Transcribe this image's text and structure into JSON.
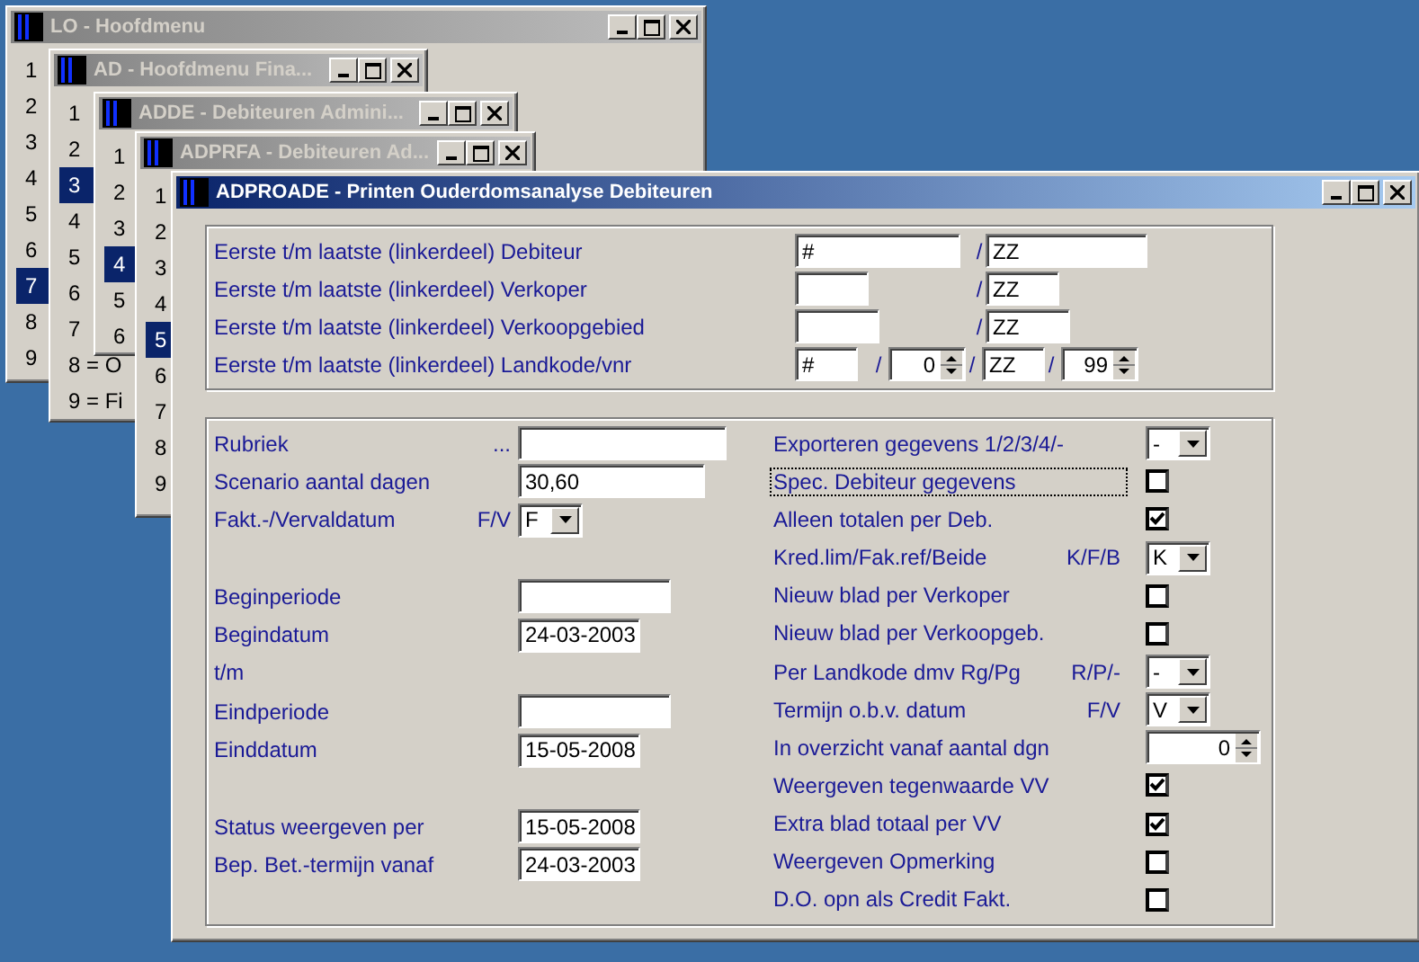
{
  "back_windows": [
    {
      "title": "LO - Hoofdmenu",
      "items": [
        {
          "label": "1",
          "selected": false
        },
        {
          "label": "2",
          "selected": false
        },
        {
          "label": "3",
          "selected": false
        },
        {
          "label": "4",
          "selected": false
        },
        {
          "label": "5",
          "selected": false
        },
        {
          "label": "6",
          "selected": false
        },
        {
          "label": "7",
          "selected": true
        },
        {
          "label": "8",
          "selected": false
        },
        {
          "label": "9",
          "selected": false
        }
      ]
    },
    {
      "title": "AD - Hoofdmenu Fina...",
      "items": [
        {
          "label": "1",
          "selected": false
        },
        {
          "label": "2",
          "selected": false
        },
        {
          "label": "3",
          "selected": true
        },
        {
          "label": "4",
          "selected": false
        },
        {
          "label": "5",
          "selected": false
        },
        {
          "label": "6",
          "selected": false
        },
        {
          "label": "7",
          "selected": false
        },
        {
          "label": "8 = O",
          "selected": false
        },
        {
          "label": "9 = Fi",
          "selected": false
        }
      ]
    },
    {
      "title": "ADDE - Debiteuren Admini...",
      "items": [
        {
          "label": "1",
          "selected": false
        },
        {
          "label": "2",
          "selected": false
        },
        {
          "label": "3",
          "selected": false
        },
        {
          "label": "4",
          "selected": true
        },
        {
          "label": "5",
          "selected": false
        },
        {
          "label": "6",
          "selected": false
        }
      ]
    },
    {
      "title": "ADPRFA - Debiteuren Ad...",
      "items": [
        {
          "label": "1",
          "selected": false
        },
        {
          "label": "2",
          "selected": false
        },
        {
          "label": "3",
          "selected": false
        },
        {
          "label": "4",
          "selected": false
        },
        {
          "label": "5",
          "selected": true
        },
        {
          "label": "6",
          "selected": false
        },
        {
          "label": "7",
          "selected": false
        },
        {
          "label": "8",
          "selected": false
        },
        {
          "label": "9",
          "selected": false
        }
      ]
    }
  ],
  "window": {
    "title": "ADPROADE - Printen Ouderdomsanalyse Debiteuren"
  },
  "range_rows": [
    {
      "label": "Eerste t/m laatste (linkerdeel) Debiteur",
      "fields": [
        {
          "kind": "text",
          "value": "#"
        },
        {
          "kind": "sep",
          "text": "/"
        },
        {
          "kind": "text",
          "value": "ZZ"
        }
      ]
    },
    {
      "label": "Eerste t/m laatste (linkerdeel) Verkoper",
      "fields": [
        {
          "kind": "text"
        },
        {
          "kind": "sep",
          "text": "/"
        },
        {
          "kind": "text",
          "value": "ZZ"
        }
      ]
    },
    {
      "label": "Eerste t/m laatste (linkerdeel) Verkoopgebied",
      "fields": [
        {
          "kind": "text"
        },
        {
          "kind": "sep",
          "text": "/"
        },
        {
          "kind": "text",
          "value": "ZZ"
        }
      ]
    },
    {
      "label": "Eerste t/m laatste (linkerdeel) Landkode/vnr",
      "fields": [
        {
          "kind": "text",
          "value": "#"
        },
        {
          "kind": "sep",
          "text": "/"
        },
        {
          "kind": "spin",
          "value": "0"
        },
        {
          "kind": "sep",
          "text": "/"
        },
        {
          "kind": "text",
          "value": "ZZ"
        },
        {
          "kind": "sep",
          "text": "/"
        },
        {
          "kind": "spin",
          "value": "99"
        }
      ]
    }
  ],
  "left_options": [
    {
      "kind": "text",
      "label": "Rubriek",
      "code": "..."
    },
    {
      "kind": "text",
      "label": "Scenario aantal dagen",
      "value": "30,60"
    },
    {
      "kind": "select",
      "label": "Fakt.-/Vervaldatum",
      "code": "F/V",
      "value": "F"
    },
    {
      "kind": "spacer"
    },
    {
      "kind": "text",
      "label": "Beginperiode"
    },
    {
      "kind": "text",
      "label": "Begindatum",
      "value": "24-03-2003"
    },
    {
      "kind": "note",
      "label": "t/m"
    },
    {
      "kind": "text",
      "label": "Eindperiode"
    },
    {
      "kind": "text",
      "label": "Einddatum",
      "value": "15-05-2008"
    },
    {
      "kind": "spacer"
    },
    {
      "kind": "text",
      "label": "Status weergeven per",
      "value": "15-05-2008"
    },
    {
      "kind": "text",
      "label": "Bep. Bet.-termijn vanaf",
      "value": "24-03-2003"
    }
  ],
  "right_options": [
    {
      "kind": "select",
      "label": "Exporteren gegevens 1/2/3/4/-",
      "value": "-"
    },
    {
      "kind": "checkbox",
      "label": "Spec. Debiteur gegevens",
      "checked": false,
      "focused": true
    },
    {
      "kind": "checkbox",
      "label": "Alleen totalen per Deb.",
      "checked": true,
      "focused": false
    },
    {
      "kind": "select",
      "label": "Kred.lim/Fak.ref/Beide",
      "code": "K/F/B",
      "value": "K"
    },
    {
      "kind": "checkbox",
      "label": "Nieuw blad per Verkoper",
      "checked": false,
      "focused": false
    },
    {
      "kind": "checkbox",
      "label": "Nieuw blad per Verkoopgeb.",
      "checked": false,
      "focused": false
    },
    {
      "kind": "select",
      "label": "Per Landkode dmv Rg/Pg",
      "code": "R/P/-",
      "value": "-"
    },
    {
      "kind": "select",
      "label": "Termijn o.b.v. datum",
      "code": "F/V",
      "value": "V"
    },
    {
      "kind": "spin",
      "label": "In overzicht vanaf aantal dgn",
      "value": "0"
    },
    {
      "kind": "checkbox",
      "label": "Weergeven tegenwaarde VV",
      "checked": true,
      "focused": false
    },
    {
      "kind": "checkbox",
      "label": "Extra blad totaal per VV",
      "checked": true,
      "focused": false
    },
    {
      "kind": "checkbox",
      "label": "Weergeven Opmerking",
      "checked": false,
      "focused": false
    },
    {
      "kind": "checkbox",
      "label": "D.O. opn als Credit Fakt.",
      "checked": false,
      "focused": false
    }
  ]
}
